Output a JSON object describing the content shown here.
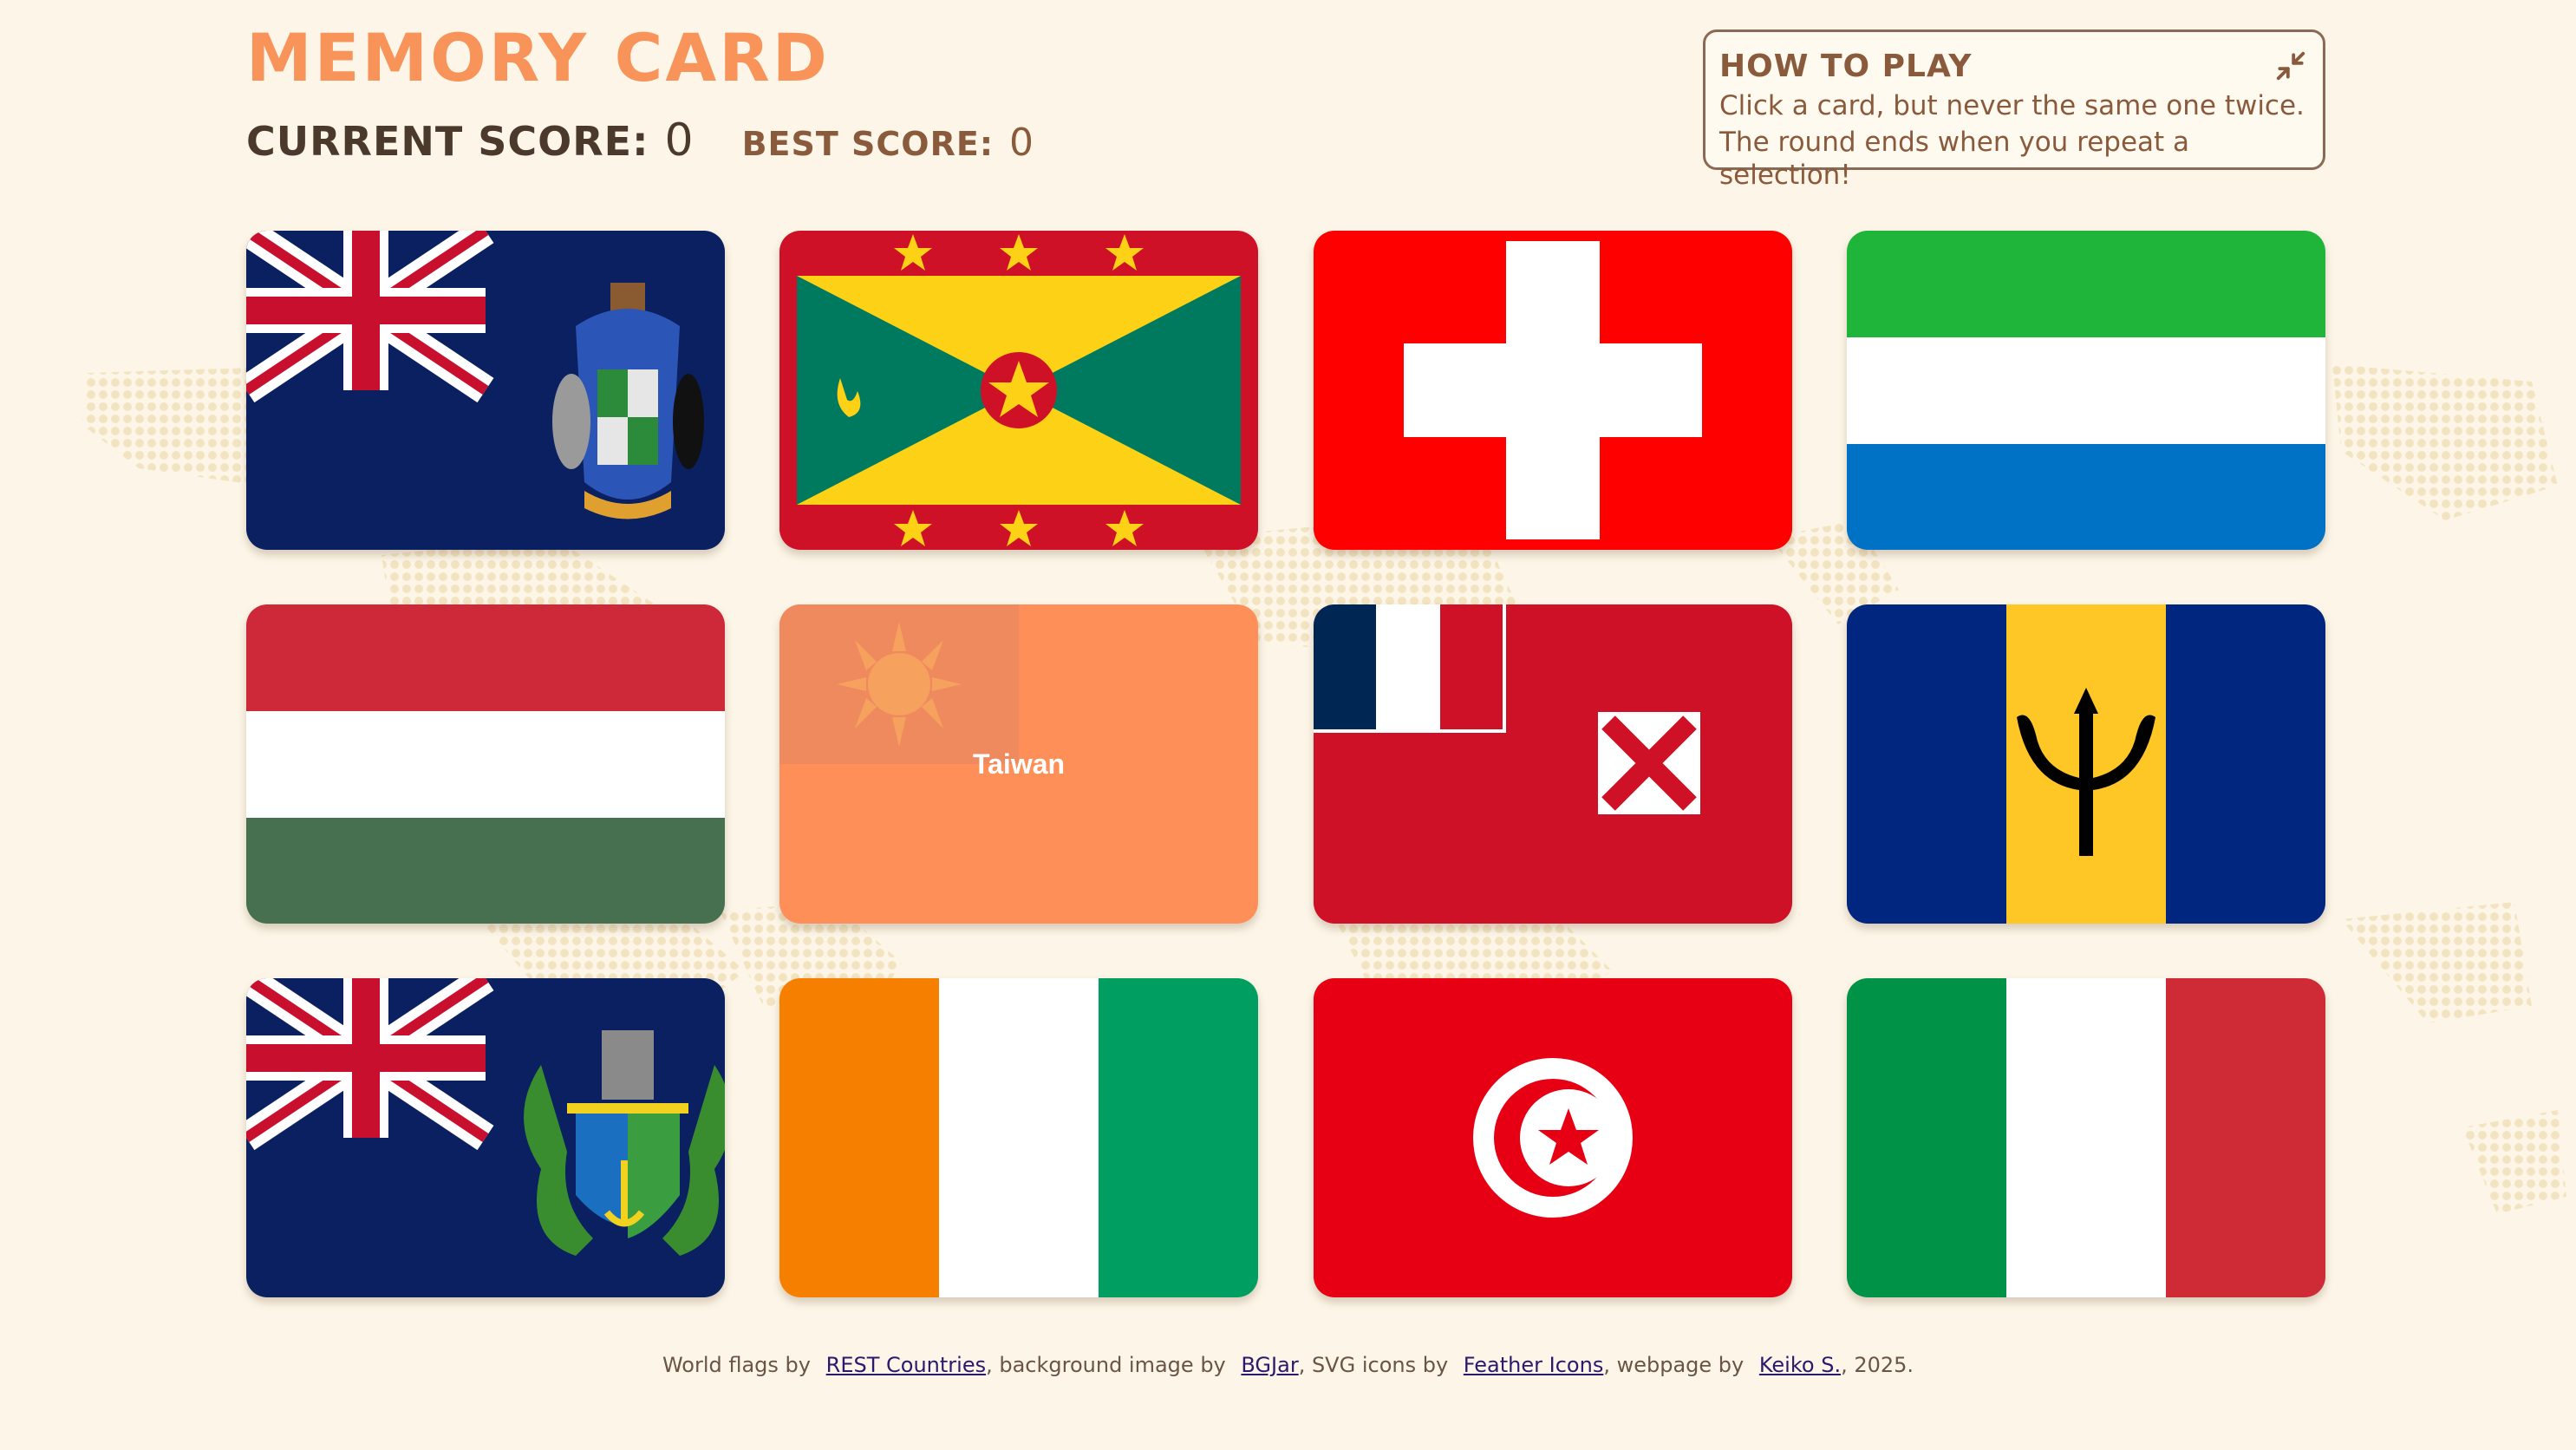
{
  "app": {
    "title": "MEMORY CARD",
    "current_score_label": "CURRENT SCORE:",
    "current_score": "0",
    "best_score_label": "BEST SCORE:",
    "best_score": "0"
  },
  "howto": {
    "title": "HOW TO PLAY",
    "line1": "Click a card, but never the same one twice.",
    "line2": "The round ends when you repeat a selection!",
    "collapse_icon": "minimize-icon"
  },
  "cards": [
    {
      "flag": "south-georgia"
    },
    {
      "flag": "grenada"
    },
    {
      "flag": "switzerland"
    },
    {
      "flag": "sierra-leone"
    },
    {
      "flag": "hungary"
    },
    {
      "flag": "taiwan",
      "label": "Taiwan"
    },
    {
      "flag": "wallis-and-futuna"
    },
    {
      "flag": "barbados"
    },
    {
      "flag": "pitcairn-islands"
    },
    {
      "flag": "ivory-coast"
    },
    {
      "flag": "tunisia"
    },
    {
      "flag": "italy"
    }
  ],
  "footer": {
    "t1": "World flags by",
    "l1": "REST Countries",
    "t2": ", background image by",
    "l2": "BGJar",
    "t3": ", SVG icons by",
    "l3": "Feather Icons",
    "t4": ", webpage by",
    "l4": "Keiko S.",
    "t5": ", 2025."
  },
  "colors": {
    "background": "#fdf6e8",
    "title": "#f8935a",
    "text": "#4b3a2c",
    "accent_brown": "#8a5a3c"
  }
}
